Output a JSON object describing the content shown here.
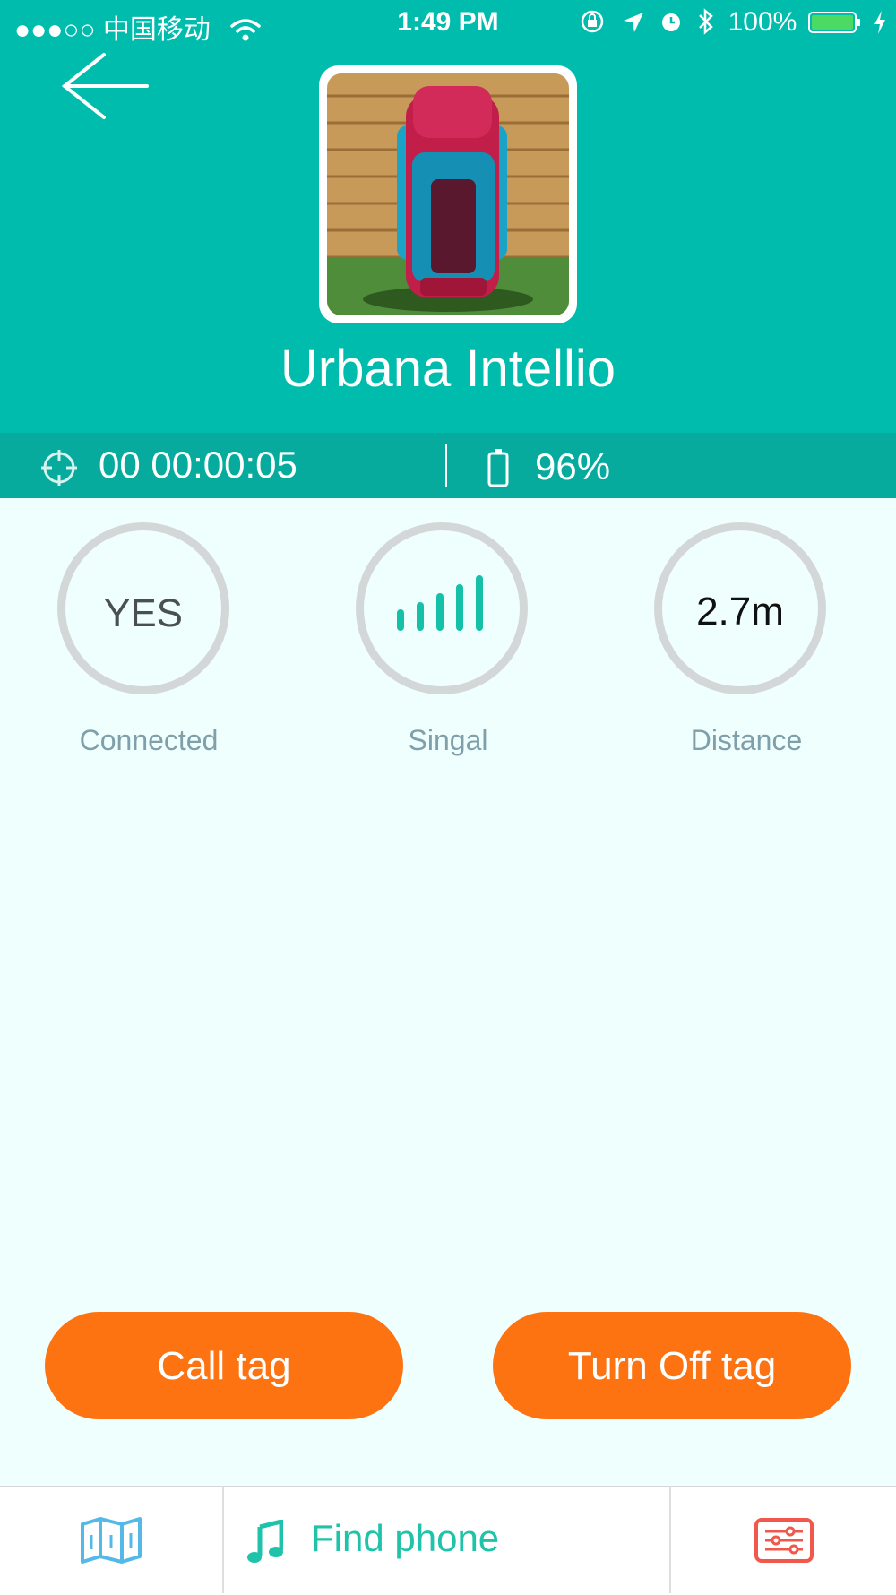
{
  "status_bar": {
    "carrier": "●●●○○ 中国移动",
    "time": "1:49 PM",
    "battery": "100%"
  },
  "header": {
    "title": "Urbana Intellio",
    "photo_subject": "backpack"
  },
  "info": {
    "elapsed": "00 00:00:05",
    "battery": "96%"
  },
  "metrics": {
    "connected": {
      "value": "YES",
      "label": "Connected"
    },
    "signal": {
      "label": "Singal",
      "bars": 5,
      "strength": 1.0
    },
    "distance": {
      "value": "2.7m",
      "label": "Distance"
    }
  },
  "actions": {
    "call_tag": "Call tag",
    "turn_off_tag": "Turn Off tag"
  },
  "tabbar": {
    "find_phone": "Find phone"
  },
  "colors": {
    "teal": "#00bcad",
    "teal_dark": "#06ab9e",
    "orange": "#fd7312",
    "background": "#effffd",
    "map_icon": "#55b9e8",
    "settings_icon": "#f0584c",
    "find_phone": "#1fc3aa"
  },
  "icons": {
    "back": "back-arrow-icon",
    "timer": "crosshair-icon",
    "battery": "battery-icon",
    "map": "map-icon",
    "music": "music-note-icon",
    "settings": "sliders-icon"
  }
}
